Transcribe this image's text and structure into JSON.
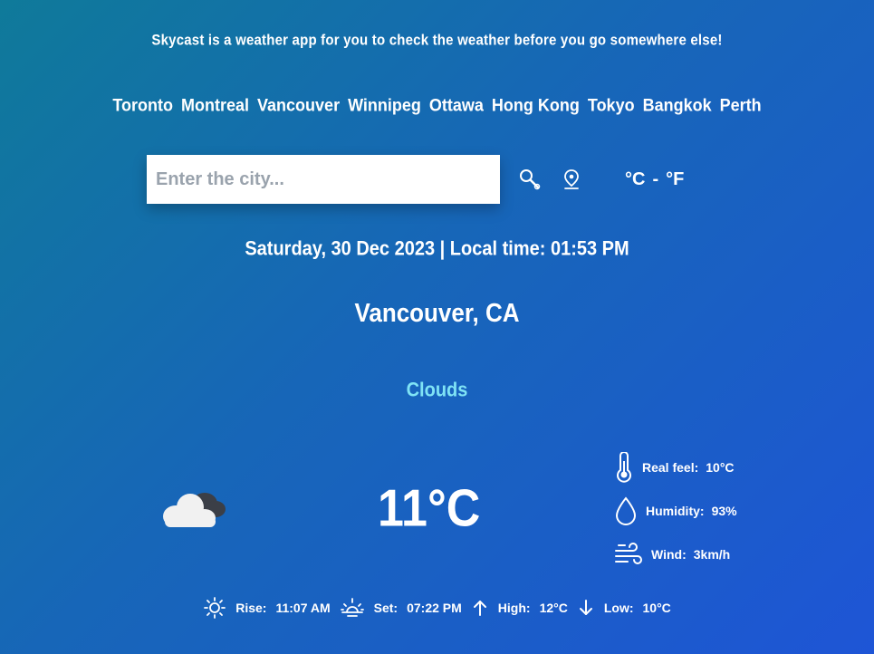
{
  "tagline": "Skycast is a weather app for you to check the weather before you go somewhere else!",
  "cities": [
    "Toronto",
    "Montreal",
    "Vancouver",
    "Winnipeg",
    "Ottawa",
    "Hong Kong",
    "Tokyo",
    "Bangkok",
    "Perth"
  ],
  "search": {
    "placeholder": "Enter the city...",
    "value": ""
  },
  "icons": {
    "search": "search-icon",
    "location": "location-pin-icon",
    "weather": "clouds-icon",
    "real_feel": "thermometer-icon",
    "humidity": "droplet-icon",
    "wind": "wind-icon",
    "sunrise": "sunrise-icon",
    "sunset": "sunset-icon",
    "high": "arrow-up-icon",
    "low": "arrow-down-icon"
  },
  "units": {
    "celsius": "°C",
    "separator": "-",
    "fahrenheit": "°F"
  },
  "datetime": "Saturday, 30 Dec 2023 | Local time: 01:53 PM",
  "location": "Vancouver, CA",
  "condition": "Clouds",
  "temperature": "11°C",
  "details": {
    "real_feel_label": "Real feel:",
    "real_feel_value": "10°C",
    "humidity_label": "Humidity:",
    "humidity_value": "93%",
    "wind_label": "Wind:",
    "wind_value": "3km/h"
  },
  "bottom": {
    "rise_label": "Rise:",
    "rise_value": "11:07 AM",
    "set_label": "Set:",
    "set_value": "07:22 PM",
    "high_label": "High:",
    "high_value": "12°C",
    "low_label": "Low:",
    "low_value": "10°C"
  },
  "colors": {
    "condition": "#7fe3f5",
    "gradient_start": "#0f7a9a",
    "gradient_end": "#1e55d6"
  }
}
